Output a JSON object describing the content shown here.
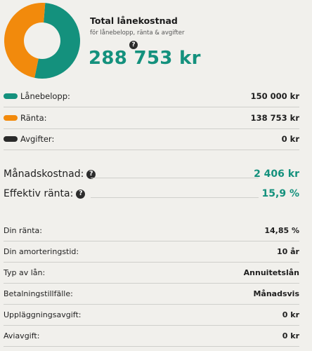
{
  "summary": {
    "title": "Total lånekostnad",
    "subtitle": "för lånebelopp, ränta & avgifter",
    "total": "288 753 kr"
  },
  "chart_data": {
    "type": "pie",
    "categories": [
      "Lånebelopp",
      "Ränta",
      "Avgifter"
    ],
    "values": [
      150000,
      138753,
      0
    ],
    "colors": [
      "#14917d",
      "#f28a0c",
      "#2a2a2a"
    ]
  },
  "breakdown": [
    {
      "label": "Lånebelopp:",
      "value": "150 000 kr",
      "color": "#14917d"
    },
    {
      "label": "Ränta:",
      "value": "138 753 kr",
      "color": "#f28a0c"
    },
    {
      "label": "Avgifter:",
      "value": "0 kr",
      "color": "#2a2a2a"
    }
  ],
  "key_figures": {
    "monthly": {
      "label": "Månadskostnad:",
      "value": "2 406 kr"
    },
    "effective": {
      "label": "Effektiv ränta:",
      "value": "15,9 %"
    }
  },
  "details": [
    {
      "label": "Din ränta:",
      "value": "14,85 %"
    },
    {
      "label": "Din amorteringstid:",
      "value": "10 år"
    },
    {
      "label": "Typ av lån:",
      "value": "Annuitetslån"
    },
    {
      "label": "Betalningstillfälle:",
      "value": "Månadsvis"
    },
    {
      "label": "Uppläggningsavgift:",
      "value": "0 kr"
    },
    {
      "label": "Aviavgift:",
      "value": "0 kr"
    }
  ],
  "help_glyph": "?"
}
